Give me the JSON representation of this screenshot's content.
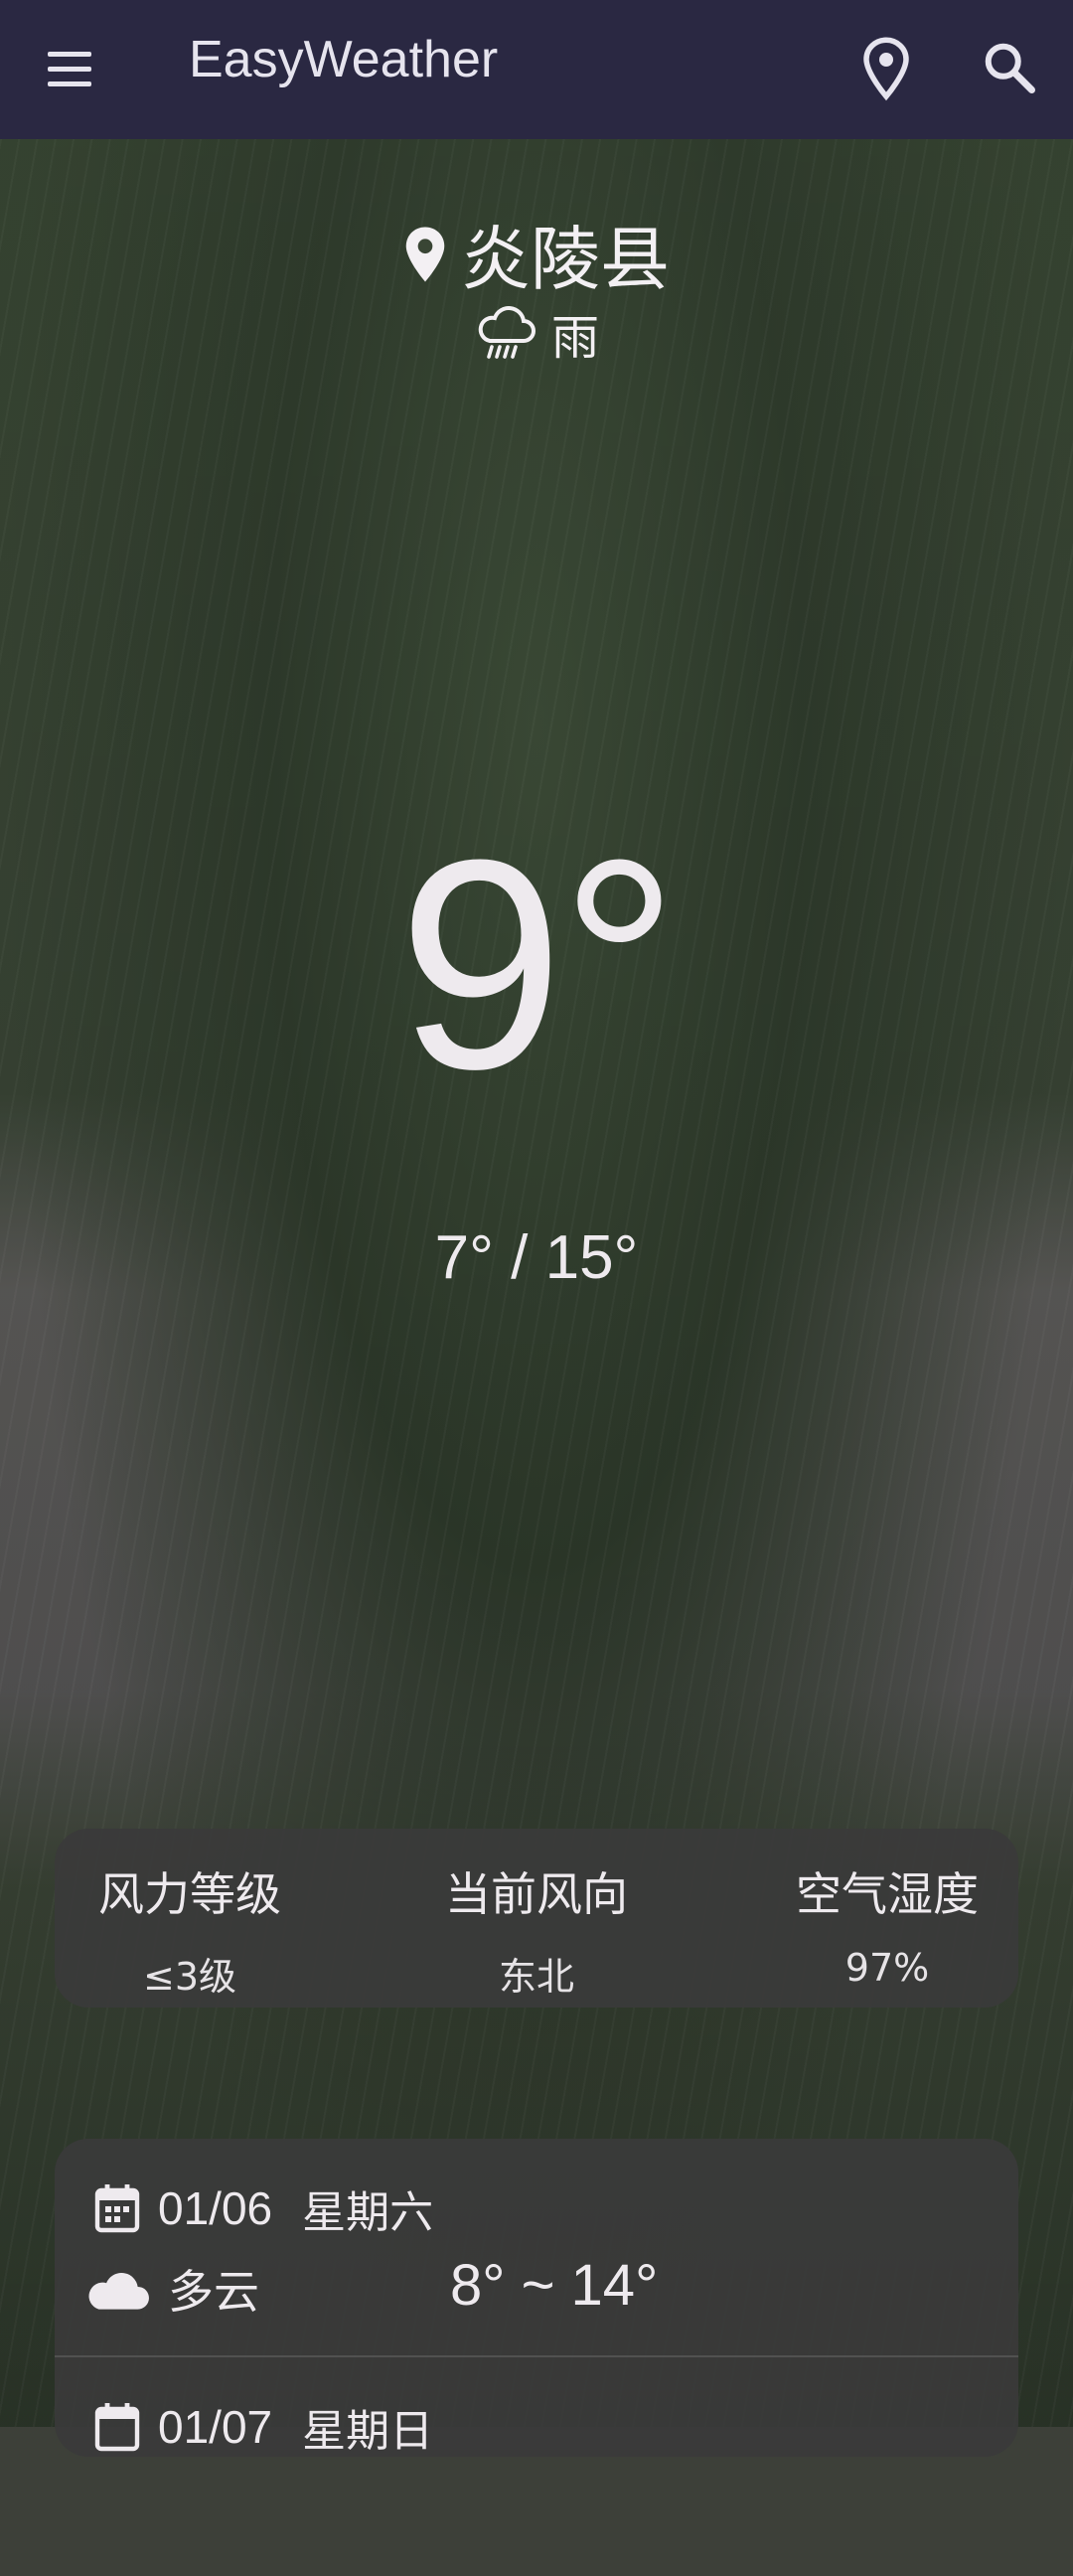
{
  "app": {
    "title": "EasyWeather"
  },
  "toolbar": {
    "menu_icon": "menu-icon",
    "location_icon": "location-pin-icon",
    "search_icon": "search-icon"
  },
  "current": {
    "city": "炎陵县",
    "condition": "雨",
    "condition_icon": "rain-cloud-icon",
    "temperature": "9°",
    "range": "7° / 15°"
  },
  "details": [
    {
      "label": "风力等级",
      "value": "≤3级"
    },
    {
      "label": "当前风向",
      "value": "东北"
    },
    {
      "label": "空气湿度",
      "value": "97%"
    }
  ],
  "forecast": [
    {
      "date": "01/06",
      "weekday": "星期六",
      "condition": "多云",
      "condition_icon": "cloud-icon",
      "temp_range": "8° ~ 14°"
    },
    {
      "date": "01/07",
      "weekday": "星期日"
    }
  ],
  "colors": {
    "toolbar_bg": "#2a2842",
    "card_bg": "#3a3a3a",
    "text": "#eeeaee"
  }
}
